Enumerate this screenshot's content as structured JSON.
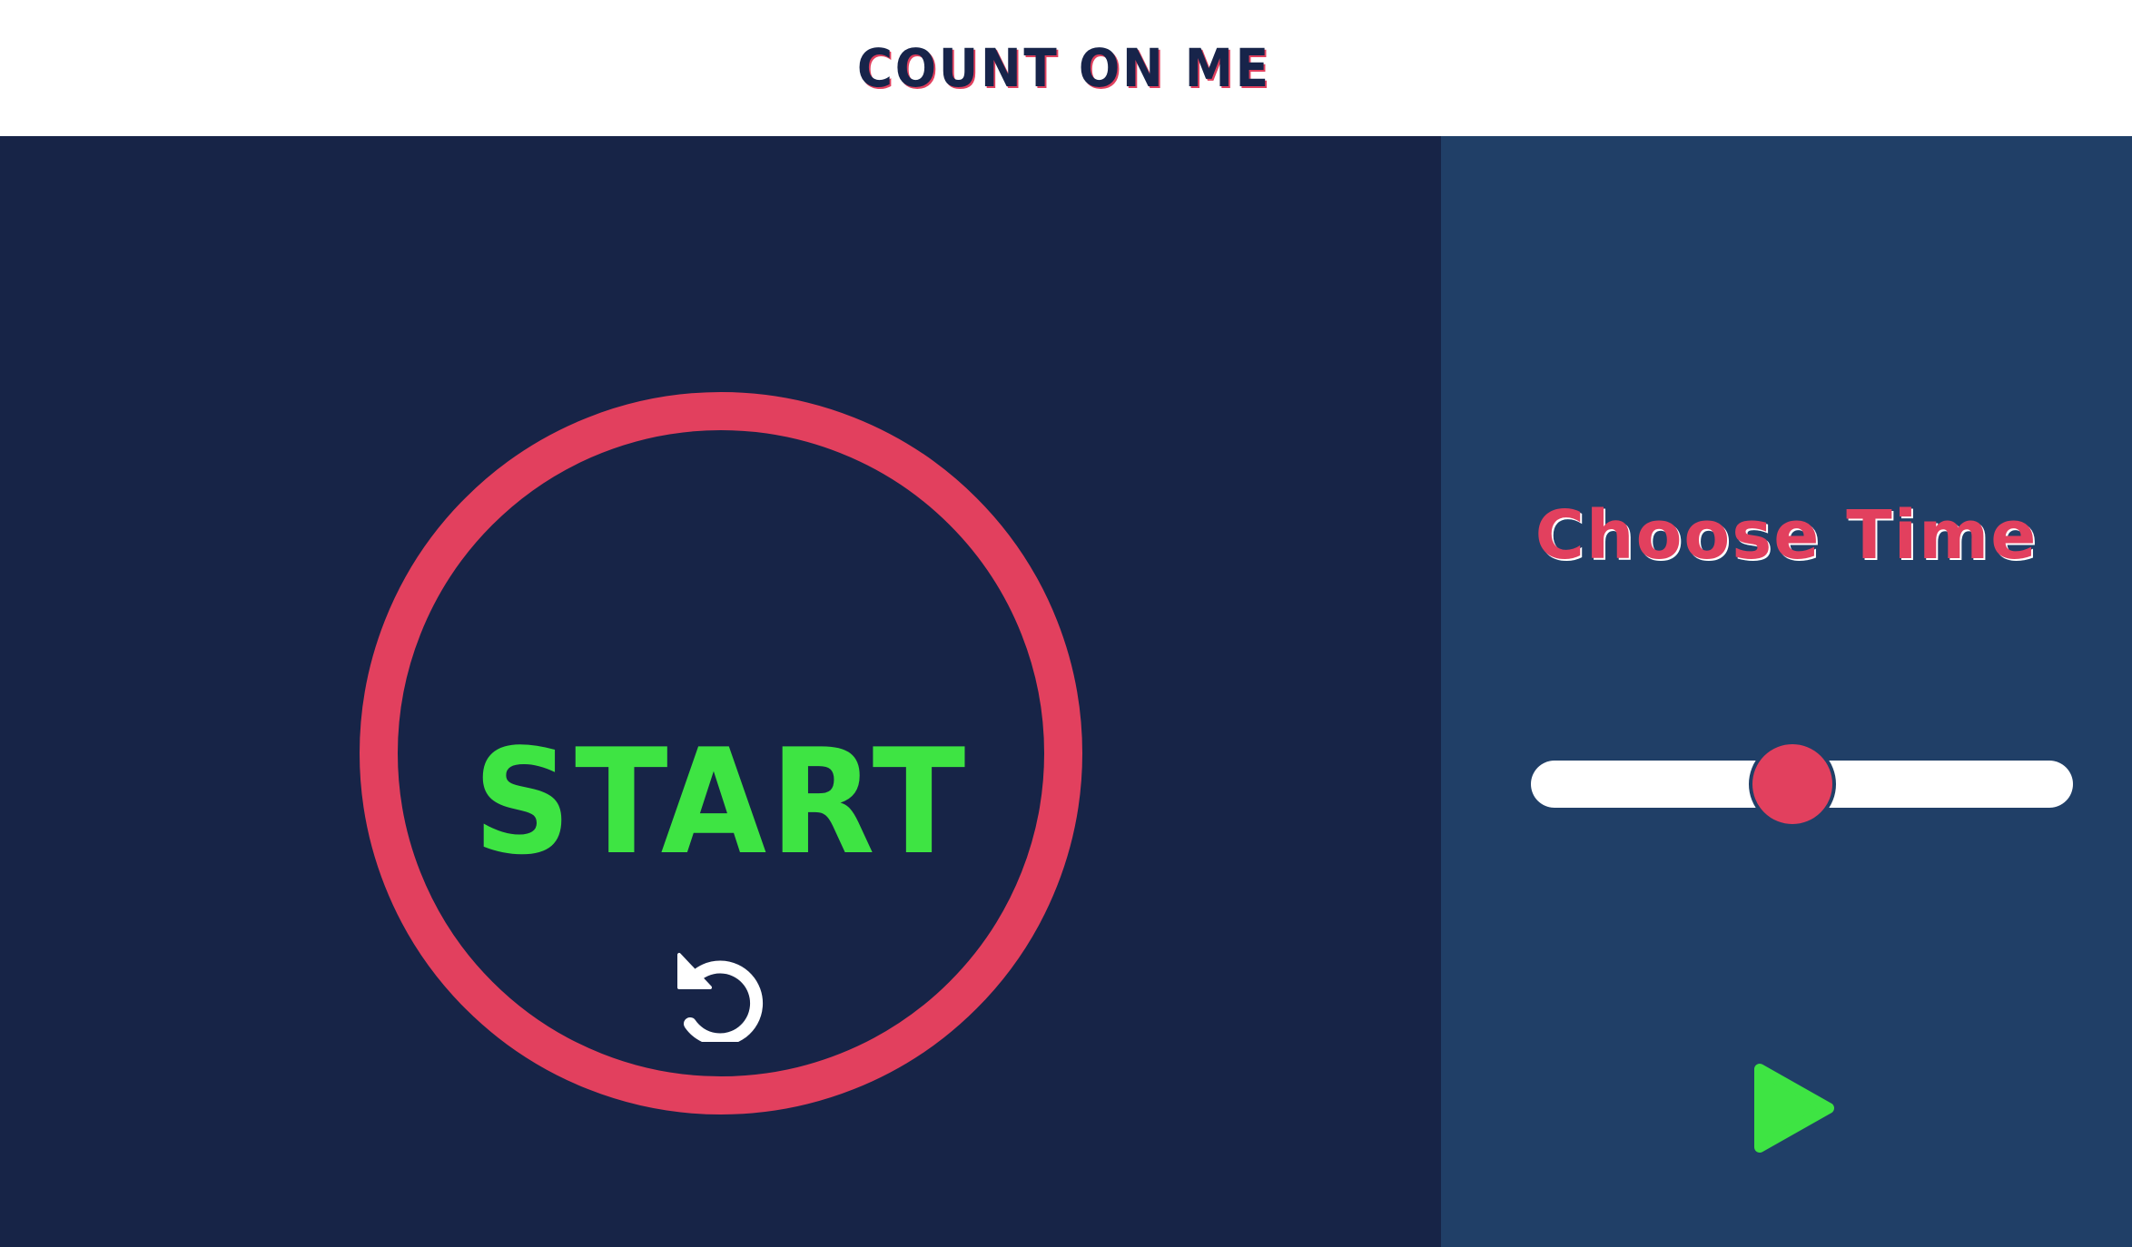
{
  "header": {
    "title": "COUNT ON ME"
  },
  "timer": {
    "display": "START",
    "reset_icon": "reset-icon"
  },
  "controls": {
    "title": "Choose Time",
    "slider": {
      "value_fraction": 0.48
    },
    "play_icon": "play-icon"
  },
  "colors": {
    "ring": "#e2405e",
    "display_text": "#3ee443",
    "header_text": "#17244a",
    "timer_bg": "#172447",
    "controls_bg": "#203f67",
    "play": "#3ee443",
    "slider_thumb": "#e2405e",
    "slider_track": "#ffffff"
  }
}
